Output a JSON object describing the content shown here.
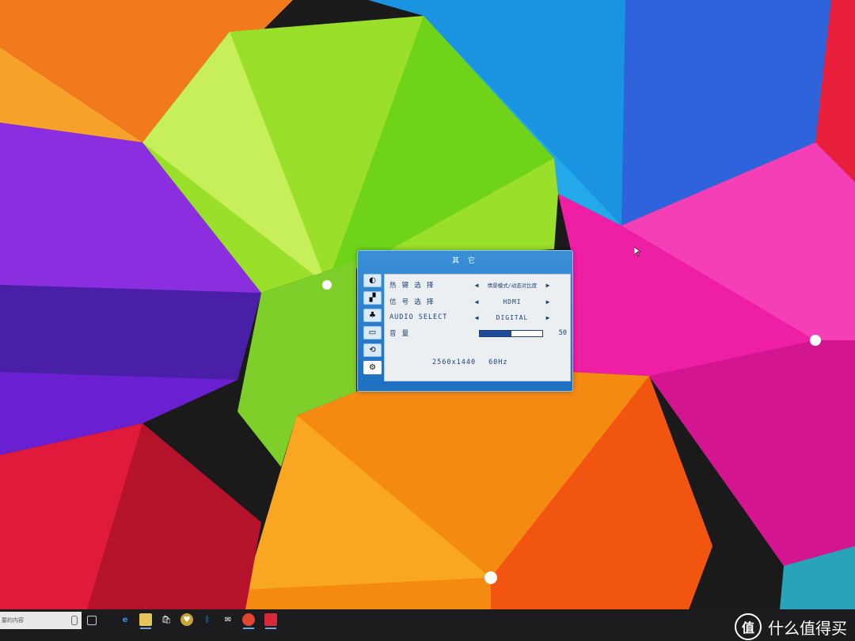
{
  "osd": {
    "title": "其 它",
    "sidebar_icons": [
      "brightness-icon",
      "image-icon",
      "color-icon",
      "screen-icon",
      "reset-icon",
      "settings-icon"
    ],
    "rows": [
      {
        "label": "热 键 选 择",
        "value": "情景模式/动态对比度"
      },
      {
        "label": "信 号 选 择",
        "value": "HDMI"
      },
      {
        "label": "AUDIO SELECT",
        "value": "DIGITAL"
      }
    ],
    "volume": {
      "label": "音 量",
      "value": 50,
      "max": 100
    },
    "resolution": "2560x1440",
    "refresh_rate": "60Hz",
    "colors": {
      "panel_bg": "#eceff2",
      "frame": "#2f82cf",
      "text": "#1f3f74",
      "bar_fill": "#1f4a9b"
    }
  },
  "taskbar": {
    "search_placeholder": "要的内容",
    "apps": [
      "task-view-icon",
      "edge-icon",
      "file-explorer-icon",
      "store-icon",
      "app-icon",
      "bluetooth-icon",
      "mail-icon",
      "chrome-icon",
      "app2-icon"
    ]
  },
  "watermark": {
    "text": "什么值得买",
    "logo_glyph": "值"
  }
}
